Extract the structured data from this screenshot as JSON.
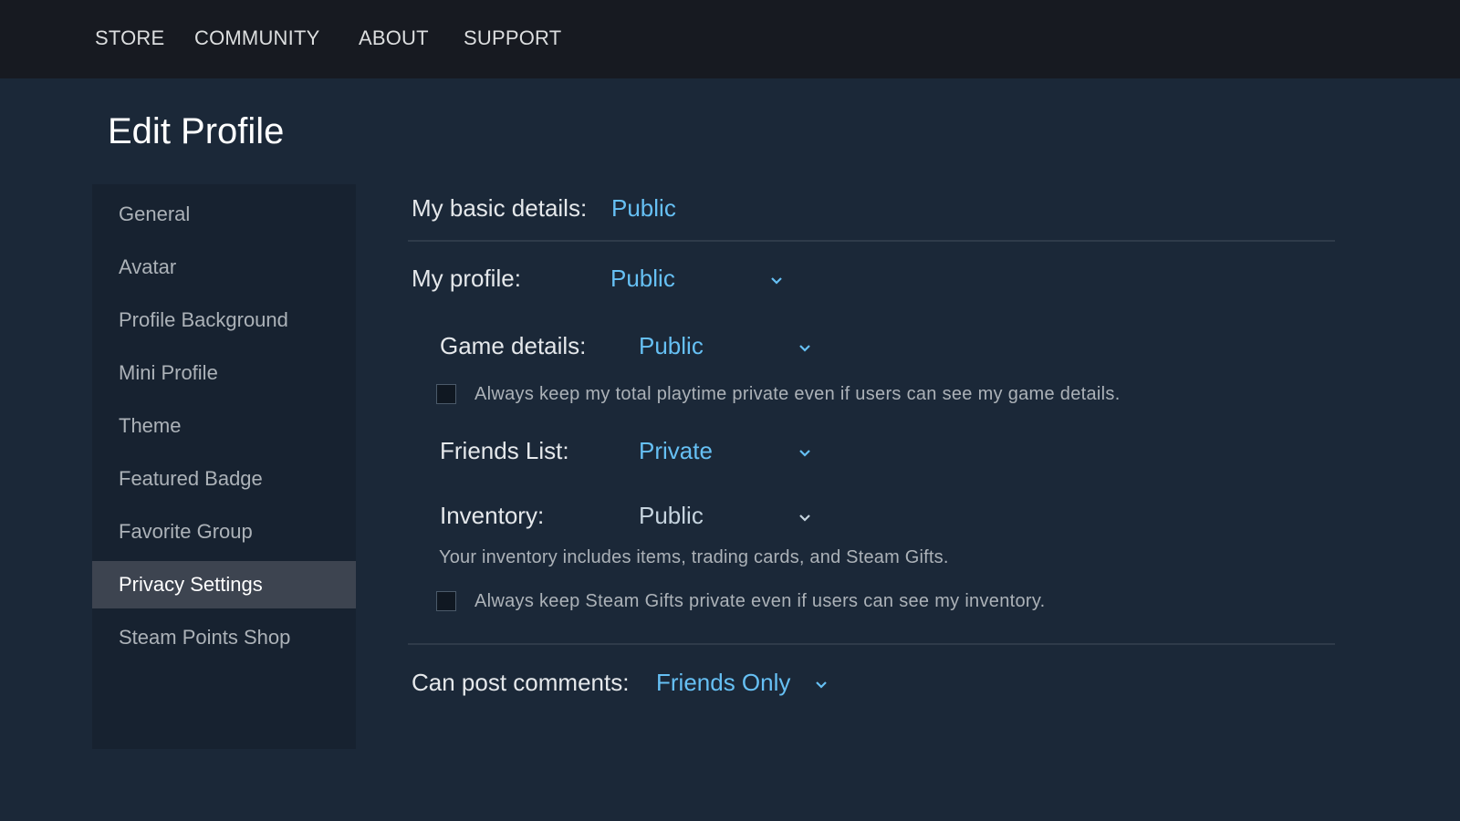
{
  "topnav": {
    "items": [
      "STORE",
      "COMMUNITY",
      "ABOUT",
      "SUPPORT"
    ]
  },
  "page_title": "Edit Profile",
  "sidebar": {
    "items": [
      {
        "label": "General"
      },
      {
        "label": "Avatar"
      },
      {
        "label": "Profile Background"
      },
      {
        "label": "Mini Profile"
      },
      {
        "label": "Theme"
      },
      {
        "label": "Featured Badge"
      },
      {
        "label": "Favorite Group"
      },
      {
        "label": "Privacy Settings",
        "active": true
      },
      {
        "label": "Steam Points Shop"
      }
    ]
  },
  "privacy": {
    "basic_details": {
      "label": "My basic details:",
      "value": "Public"
    },
    "profile": {
      "label": "My profile:",
      "value": "Public",
      "icon": "chevron-down-icon"
    },
    "game_details": {
      "label": "Game details:",
      "value": "Public",
      "icon": "chevron-down-icon"
    },
    "playtime_checkbox": {
      "label": "Always keep my total playtime private even if users can see my game details.",
      "checked": false
    },
    "friends_list": {
      "label": "Friends List:",
      "value": "Private",
      "icon": "chevron-down-icon"
    },
    "inventory": {
      "label": "Inventory:",
      "value": "Public",
      "icon": "chevron-down-icon"
    },
    "inventory_note": "Your inventory includes items, trading cards, and Steam Gifts.",
    "gifts_checkbox": {
      "label": "Always keep Steam Gifts private even if users can see my inventory.",
      "checked": false
    },
    "comments": {
      "label": "Can post comments:",
      "value": "Friends Only",
      "icon": "chevron-down-icon"
    }
  },
  "colors": {
    "background": "#1b2838",
    "topbar": "#171a21",
    "sidebar": "#172230",
    "sidebar_active": "#3d4450",
    "accent": "#66c0f4"
  }
}
